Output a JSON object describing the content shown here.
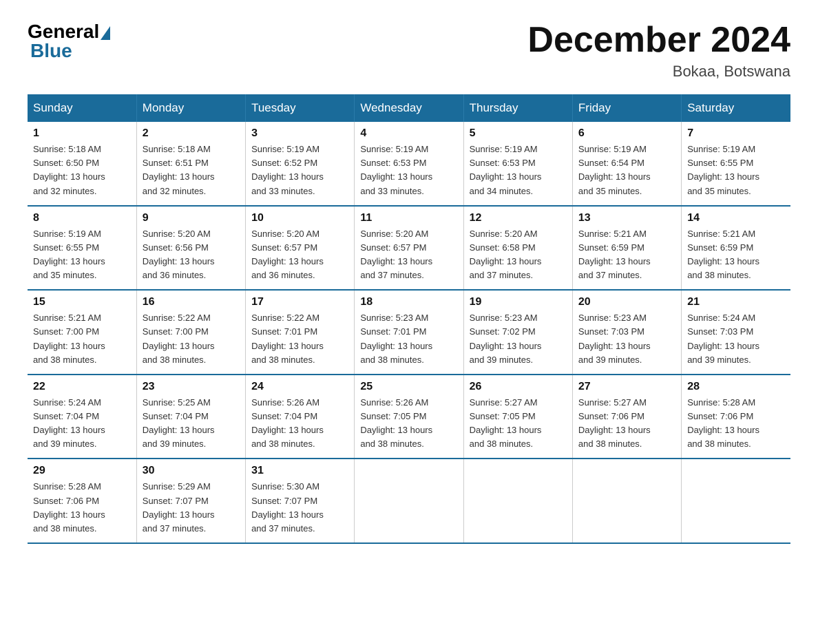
{
  "logo": {
    "general": "General",
    "blue": "Blue"
  },
  "title": "December 2024",
  "location": "Bokaa, Botswana",
  "header_color": "#1a6b9a",
  "days_of_week": [
    "Sunday",
    "Monday",
    "Tuesday",
    "Wednesday",
    "Thursday",
    "Friday",
    "Saturday"
  ],
  "weeks": [
    [
      {
        "day": "1",
        "sunrise": "5:18 AM",
        "sunset": "6:50 PM",
        "daylight": "13 hours and 32 minutes."
      },
      {
        "day": "2",
        "sunrise": "5:18 AM",
        "sunset": "6:51 PM",
        "daylight": "13 hours and 32 minutes."
      },
      {
        "day": "3",
        "sunrise": "5:19 AM",
        "sunset": "6:52 PM",
        "daylight": "13 hours and 33 minutes."
      },
      {
        "day": "4",
        "sunrise": "5:19 AM",
        "sunset": "6:53 PM",
        "daylight": "13 hours and 33 minutes."
      },
      {
        "day": "5",
        "sunrise": "5:19 AM",
        "sunset": "6:53 PM",
        "daylight": "13 hours and 34 minutes."
      },
      {
        "day": "6",
        "sunrise": "5:19 AM",
        "sunset": "6:54 PM",
        "daylight": "13 hours and 35 minutes."
      },
      {
        "day": "7",
        "sunrise": "5:19 AM",
        "sunset": "6:55 PM",
        "daylight": "13 hours and 35 minutes."
      }
    ],
    [
      {
        "day": "8",
        "sunrise": "5:19 AM",
        "sunset": "6:55 PM",
        "daylight": "13 hours and 35 minutes."
      },
      {
        "day": "9",
        "sunrise": "5:20 AM",
        "sunset": "6:56 PM",
        "daylight": "13 hours and 36 minutes."
      },
      {
        "day": "10",
        "sunrise": "5:20 AM",
        "sunset": "6:57 PM",
        "daylight": "13 hours and 36 minutes."
      },
      {
        "day": "11",
        "sunrise": "5:20 AM",
        "sunset": "6:57 PM",
        "daylight": "13 hours and 37 minutes."
      },
      {
        "day": "12",
        "sunrise": "5:20 AM",
        "sunset": "6:58 PM",
        "daylight": "13 hours and 37 minutes."
      },
      {
        "day": "13",
        "sunrise": "5:21 AM",
        "sunset": "6:59 PM",
        "daylight": "13 hours and 37 minutes."
      },
      {
        "day": "14",
        "sunrise": "5:21 AM",
        "sunset": "6:59 PM",
        "daylight": "13 hours and 38 minutes."
      }
    ],
    [
      {
        "day": "15",
        "sunrise": "5:21 AM",
        "sunset": "7:00 PM",
        "daylight": "13 hours and 38 minutes."
      },
      {
        "day": "16",
        "sunrise": "5:22 AM",
        "sunset": "7:00 PM",
        "daylight": "13 hours and 38 minutes."
      },
      {
        "day": "17",
        "sunrise": "5:22 AM",
        "sunset": "7:01 PM",
        "daylight": "13 hours and 38 minutes."
      },
      {
        "day": "18",
        "sunrise": "5:23 AM",
        "sunset": "7:01 PM",
        "daylight": "13 hours and 38 minutes."
      },
      {
        "day": "19",
        "sunrise": "5:23 AM",
        "sunset": "7:02 PM",
        "daylight": "13 hours and 39 minutes."
      },
      {
        "day": "20",
        "sunrise": "5:23 AM",
        "sunset": "7:03 PM",
        "daylight": "13 hours and 39 minutes."
      },
      {
        "day": "21",
        "sunrise": "5:24 AM",
        "sunset": "7:03 PM",
        "daylight": "13 hours and 39 minutes."
      }
    ],
    [
      {
        "day": "22",
        "sunrise": "5:24 AM",
        "sunset": "7:04 PM",
        "daylight": "13 hours and 39 minutes."
      },
      {
        "day": "23",
        "sunrise": "5:25 AM",
        "sunset": "7:04 PM",
        "daylight": "13 hours and 39 minutes."
      },
      {
        "day": "24",
        "sunrise": "5:26 AM",
        "sunset": "7:04 PM",
        "daylight": "13 hours and 38 minutes."
      },
      {
        "day": "25",
        "sunrise": "5:26 AM",
        "sunset": "7:05 PM",
        "daylight": "13 hours and 38 minutes."
      },
      {
        "day": "26",
        "sunrise": "5:27 AM",
        "sunset": "7:05 PM",
        "daylight": "13 hours and 38 minutes."
      },
      {
        "day": "27",
        "sunrise": "5:27 AM",
        "sunset": "7:06 PM",
        "daylight": "13 hours and 38 minutes."
      },
      {
        "day": "28",
        "sunrise": "5:28 AM",
        "sunset": "7:06 PM",
        "daylight": "13 hours and 38 minutes."
      }
    ],
    [
      {
        "day": "29",
        "sunrise": "5:28 AM",
        "sunset": "7:06 PM",
        "daylight": "13 hours and 38 minutes."
      },
      {
        "day": "30",
        "sunrise": "5:29 AM",
        "sunset": "7:07 PM",
        "daylight": "13 hours and 37 minutes."
      },
      {
        "day": "31",
        "sunrise": "5:30 AM",
        "sunset": "7:07 PM",
        "daylight": "13 hours and 37 minutes."
      },
      null,
      null,
      null,
      null
    ]
  ]
}
